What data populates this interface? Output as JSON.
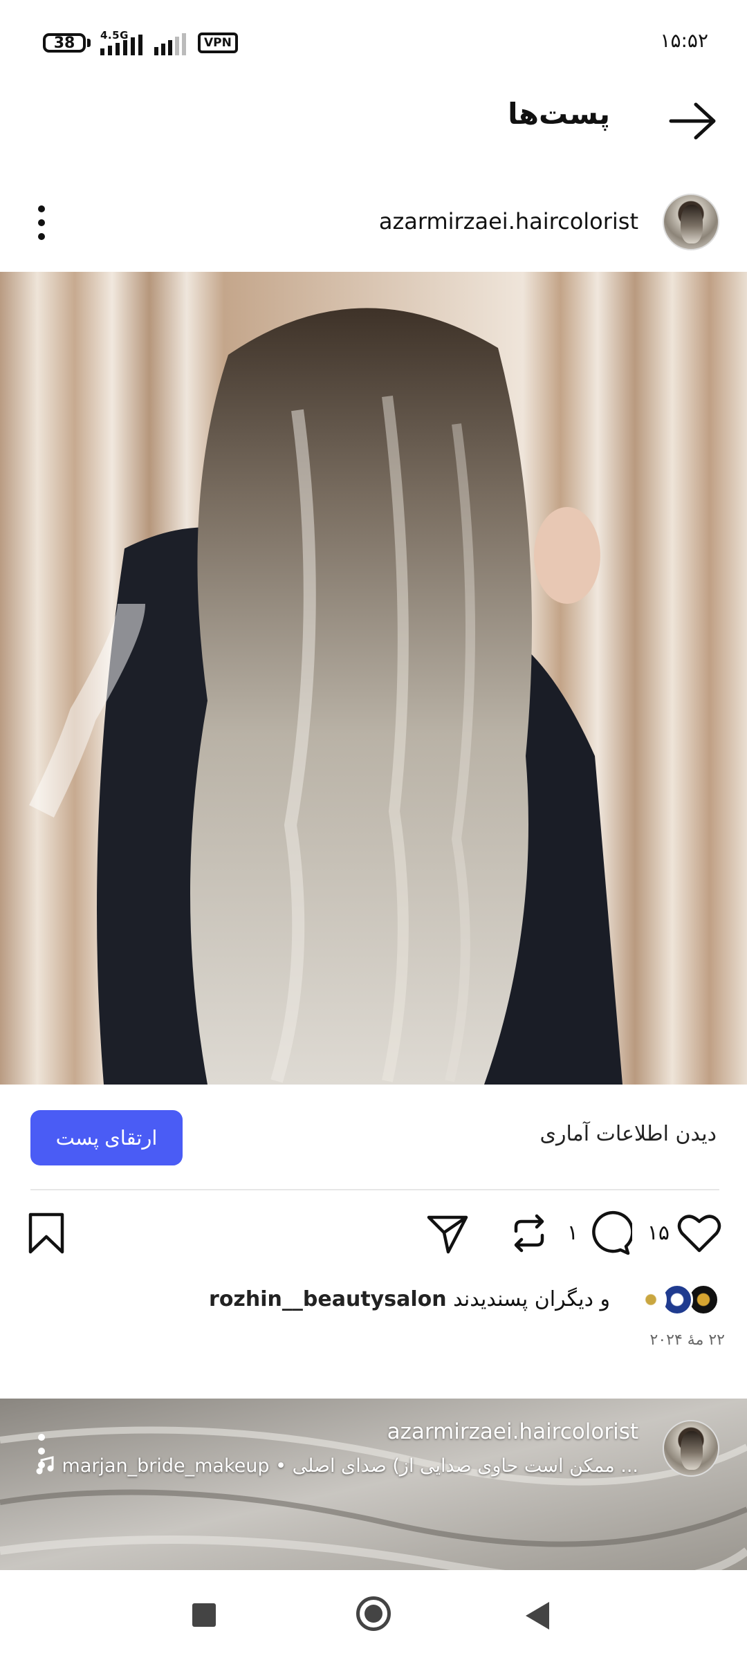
{
  "status_bar": {
    "battery": "38",
    "network": "4.5G",
    "vpn": "VPN",
    "time": "۱۵:۵۲"
  },
  "header": {
    "title": "پست‌ها",
    "back_icon": "arrow-right-icon"
  },
  "post": {
    "username": "azarmirzaei.haircolorist",
    "insights_label": "دیدن اطلاعات آماری",
    "boost_label": "ارتقای پست",
    "likes_count": "۱۵",
    "comments_count": "۱",
    "liked_by_user": "rozhin__beautysalon",
    "liked_by_suffix": "و دیگران پسندیدند",
    "date": "۲۲ مهٔ ۲۰۲۴",
    "icons": [
      "heart-icon",
      "comment-icon",
      "repost-icon",
      "share-icon",
      "bookmark-icon",
      "more-icon"
    ]
  },
  "next_post": {
    "username": "azarmirzaei.haircolorist",
    "audio": "... ممکن است حاوی صدایی از) صدای اصلی • marjan_bride_makeup"
  },
  "colors": {
    "accent": "#4a5cf5",
    "text": "#111111",
    "muted": "#666666"
  }
}
